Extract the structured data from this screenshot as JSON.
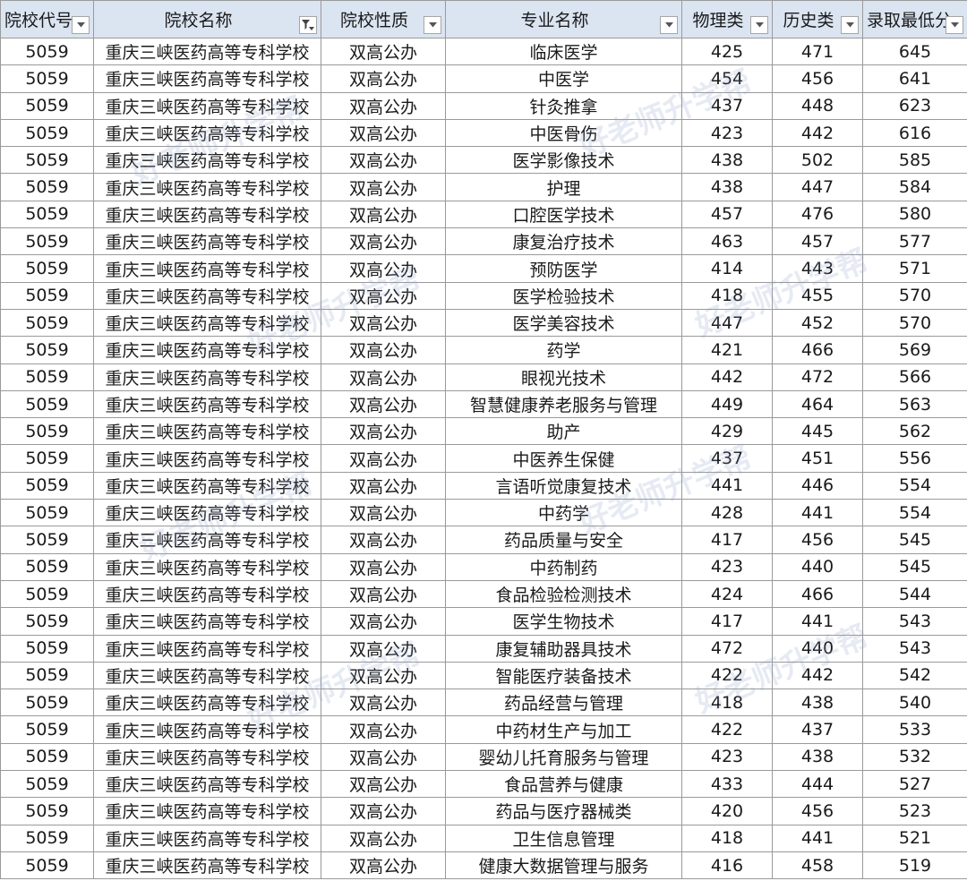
{
  "headers": [
    "院校代号",
    "院校名称",
    "院校性质",
    "专业名称",
    "物理类",
    "历史类",
    "录取最低分"
  ],
  "filter_icon_active_column": 1,
  "rows": [
    [
      "5059",
      "重庆三峡医药高等专科学校",
      "双高公办",
      "临床医学",
      "425",
      "471",
      "645"
    ],
    [
      "5059",
      "重庆三峡医药高等专科学校",
      "双高公办",
      "中医学",
      "454",
      "456",
      "641"
    ],
    [
      "5059",
      "重庆三峡医药高等专科学校",
      "双高公办",
      "针灸推拿",
      "437",
      "448",
      "623"
    ],
    [
      "5059",
      "重庆三峡医药高等专科学校",
      "双高公办",
      "中医骨伤",
      "423",
      "442",
      "616"
    ],
    [
      "5059",
      "重庆三峡医药高等专科学校",
      "双高公办",
      "医学影像技术",
      "438",
      "502",
      "585"
    ],
    [
      "5059",
      "重庆三峡医药高等专科学校",
      "双高公办",
      "护理",
      "438",
      "447",
      "584"
    ],
    [
      "5059",
      "重庆三峡医药高等专科学校",
      "双高公办",
      "口腔医学技术",
      "457",
      "476",
      "580"
    ],
    [
      "5059",
      "重庆三峡医药高等专科学校",
      "双高公办",
      "康复治疗技术",
      "463",
      "457",
      "577"
    ],
    [
      "5059",
      "重庆三峡医药高等专科学校",
      "双高公办",
      "预防医学",
      "414",
      "443",
      "571"
    ],
    [
      "5059",
      "重庆三峡医药高等专科学校",
      "双高公办",
      "医学检验技术",
      "418",
      "455",
      "570"
    ],
    [
      "5059",
      "重庆三峡医药高等专科学校",
      "双高公办",
      "医学美容技术",
      "447",
      "452",
      "570"
    ],
    [
      "5059",
      "重庆三峡医药高等专科学校",
      "双高公办",
      "药学",
      "421",
      "466",
      "569"
    ],
    [
      "5059",
      "重庆三峡医药高等专科学校",
      "双高公办",
      "眼视光技术",
      "442",
      "472",
      "566"
    ],
    [
      "5059",
      "重庆三峡医药高等专科学校",
      "双高公办",
      "智慧健康养老服务与管理",
      "449",
      "464",
      "563"
    ],
    [
      "5059",
      "重庆三峡医药高等专科学校",
      "双高公办",
      "助产",
      "429",
      "445",
      "562"
    ],
    [
      "5059",
      "重庆三峡医药高等专科学校",
      "双高公办",
      "中医养生保健",
      "437",
      "451",
      "556"
    ],
    [
      "5059",
      "重庆三峡医药高等专科学校",
      "双高公办",
      "言语听觉康复技术",
      "441",
      "446",
      "554"
    ],
    [
      "5059",
      "重庆三峡医药高等专科学校",
      "双高公办",
      "中药学",
      "428",
      "441",
      "554"
    ],
    [
      "5059",
      "重庆三峡医药高等专科学校",
      "双高公办",
      "药品质量与安全",
      "417",
      "456",
      "545"
    ],
    [
      "5059",
      "重庆三峡医药高等专科学校",
      "双高公办",
      "中药制药",
      "423",
      "440",
      "545"
    ],
    [
      "5059",
      "重庆三峡医药高等专科学校",
      "双高公办",
      "食品检验检测技术",
      "424",
      "466",
      "544"
    ],
    [
      "5059",
      "重庆三峡医药高等专科学校",
      "双高公办",
      "医学生物技术",
      "417",
      "441",
      "543"
    ],
    [
      "5059",
      "重庆三峡医药高等专科学校",
      "双高公办",
      "康复辅助器具技术",
      "472",
      "440",
      "543"
    ],
    [
      "5059",
      "重庆三峡医药高等专科学校",
      "双高公办",
      "智能医疗装备技术",
      "422",
      "442",
      "542"
    ],
    [
      "5059",
      "重庆三峡医药高等专科学校",
      "双高公办",
      "药品经营与管理",
      "418",
      "438",
      "540"
    ],
    [
      "5059",
      "重庆三峡医药高等专科学校",
      "双高公办",
      "中药材生产与加工",
      "422",
      "437",
      "533"
    ],
    [
      "5059",
      "重庆三峡医药高等专科学校",
      "双高公办",
      "婴幼儿托育服务与管理",
      "423",
      "438",
      "532"
    ],
    [
      "5059",
      "重庆三峡医药高等专科学校",
      "双高公办",
      "食品营养与健康",
      "433",
      "444",
      "527"
    ],
    [
      "5059",
      "重庆三峡医药高等专科学校",
      "双高公办",
      "药品与医疗器械类",
      "420",
      "456",
      "523"
    ],
    [
      "5059",
      "重庆三峡医药高等专科学校",
      "双高公办",
      "卫生信息管理",
      "418",
      "441",
      "521"
    ],
    [
      "5059",
      "重庆三峡医药高等专科学校",
      "双高公办",
      "健康大数据管理与服务",
      "416",
      "458",
      "519"
    ]
  ],
  "watermark_text": "好老师升学帮",
  "colors": {
    "header_bg": "#dbe4f1",
    "grid": "#9a9a9a",
    "text": "#1a1a1a"
  }
}
